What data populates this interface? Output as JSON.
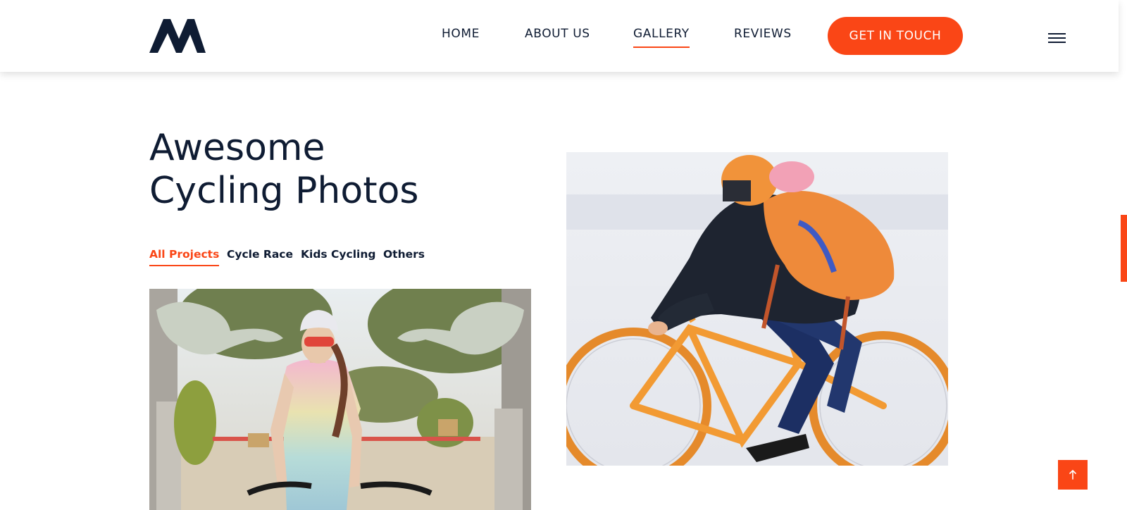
{
  "nav": {
    "items": [
      {
        "label": "HOME"
      },
      {
        "label": "ABOUT US"
      },
      {
        "label": "GALLERY",
        "active": true
      },
      {
        "label": "REVIEWS"
      }
    ],
    "cta_label": "GET IN TOUCH"
  },
  "gallery": {
    "title_line1": "Awesome",
    "title_line2": "Cycling Photos",
    "filters": [
      {
        "label": "All Projects",
        "active": true
      },
      {
        "label": "Cycle Race"
      },
      {
        "label": "Kids Cycling"
      },
      {
        "label": "Others"
      }
    ]
  },
  "icons": {
    "logo": "brand-logo-m",
    "menu": "hamburger-icon",
    "back_to_top": "arrow-up-icon"
  },
  "colors": {
    "accent": "#fa4616",
    "text": "#0f1c33"
  }
}
